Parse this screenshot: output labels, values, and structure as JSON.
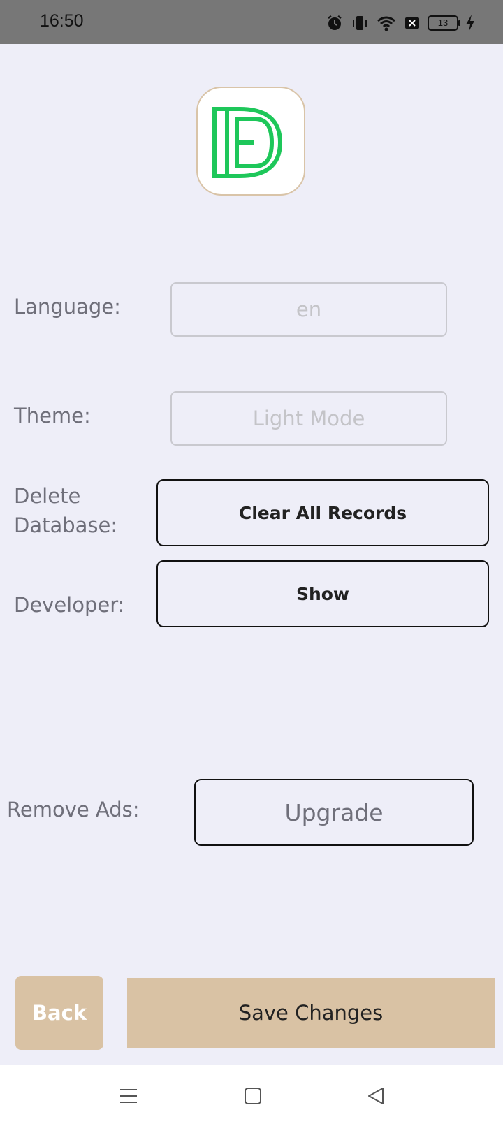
{
  "status_bar": {
    "time": "16:50",
    "battery": "13",
    "icons": [
      "alarm-icon",
      "vibrate-icon",
      "wifi-icon",
      "sim-off-icon",
      "battery-icon",
      "charging-icon"
    ]
  },
  "app": {
    "logo_icon": "app-logo-db-icon",
    "accent_color": "#1ec75a",
    "button_color": "#d9c2a4"
  },
  "settings": {
    "language_label": "Language:",
    "language_value": "en",
    "theme_label": "Theme:",
    "theme_value": "Light Mode",
    "delete_label_line1": "Delete",
    "delete_label_line2": "Database:",
    "delete_button": "Clear All Records",
    "developer_label": "Developer:",
    "developer_button": "Show",
    "remove_ads_label": "Remove Ads:",
    "remove_ads_button": "Upgrade"
  },
  "footer": {
    "back_label": "Back",
    "save_label": "Save Changes"
  },
  "nav_bar": {
    "icons": [
      "menu-icon",
      "home-square-icon",
      "back-triangle-icon"
    ]
  }
}
